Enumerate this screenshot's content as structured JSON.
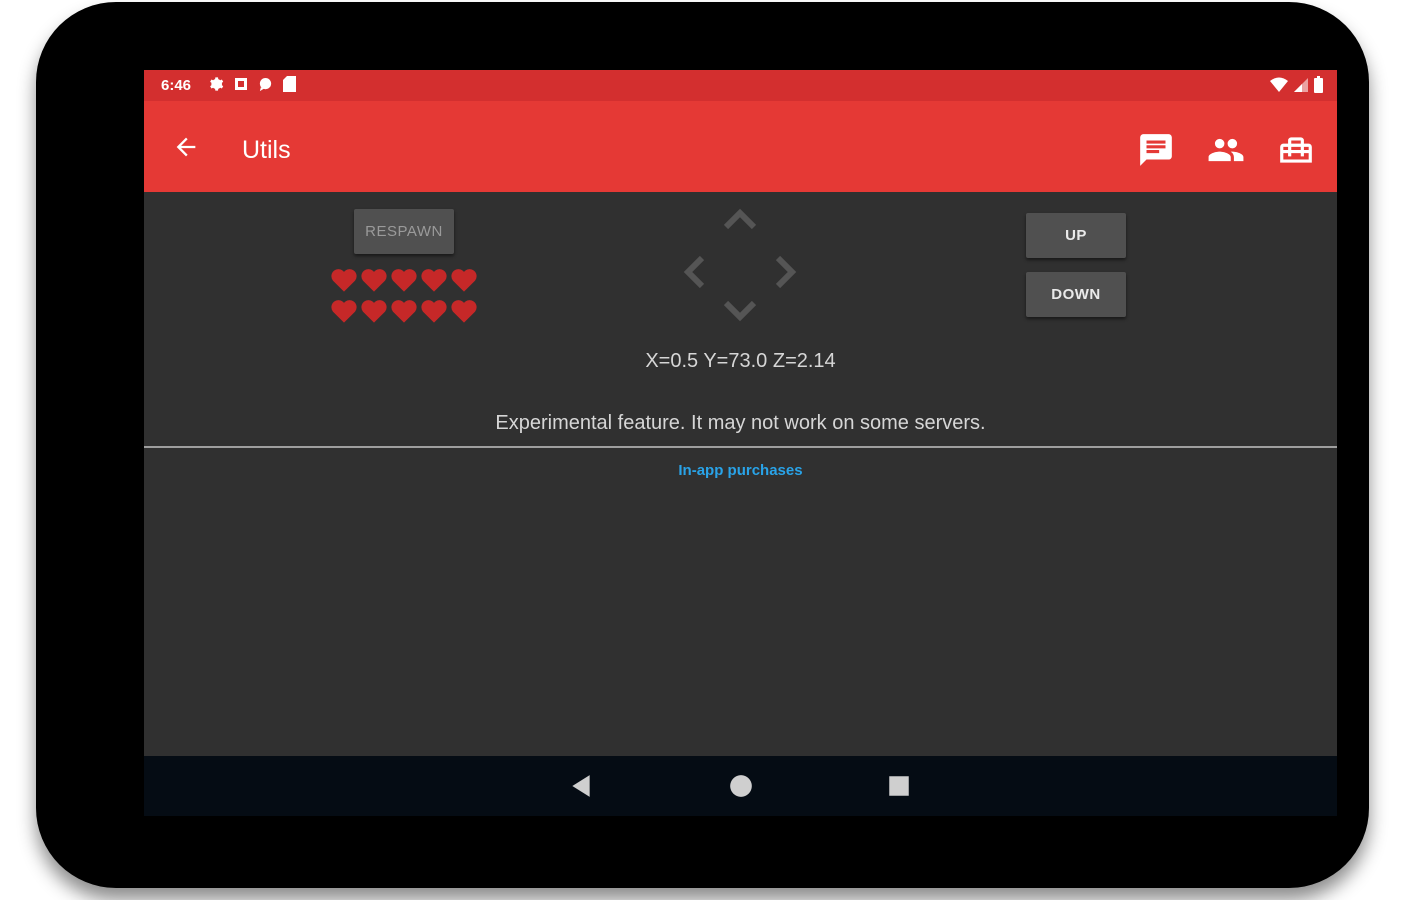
{
  "status_bar": {
    "time": "6:46",
    "left_icons": [
      "settings-icon",
      "stop-icon",
      "chat-bubble-icon",
      "sd-card-icon"
    ],
    "right_icons": [
      "wifi-icon",
      "cellular-signal-icon",
      "battery-icon"
    ]
  },
  "app_bar": {
    "title": "Utils",
    "back_icon": "arrow-back-icon",
    "actions": [
      "chat-icon",
      "people-icon",
      "toolbox-icon"
    ]
  },
  "controls": {
    "respawn_label": "RESPAWN",
    "up_label": "UP",
    "down_label": "DOWN",
    "hearts_count": 10,
    "dpad_icons": [
      "chevron-up-icon",
      "chevron-left-icon",
      "chevron-right-icon",
      "chevron-down-icon"
    ]
  },
  "position_readout": "X=0.5 Y=73.0 Z=2.14",
  "note": "Experimental feature. It may not work on some servers.",
  "link_label": "In-app purchases",
  "nav_bar": {
    "icons": [
      "nav-back-icon",
      "nav-home-icon",
      "nav-recents-icon"
    ]
  },
  "colors": {
    "status_bar": "#d32f2f",
    "app_bar": "#e53935",
    "background": "#303030",
    "button": "#505050",
    "heart": "#c62828",
    "link": "#29a3e8",
    "nav_bar": "#050c14"
  }
}
